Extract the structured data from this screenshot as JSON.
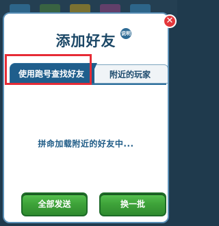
{
  "dialog": {
    "title": "添加好友",
    "badge": "说明",
    "close_icon": "close-icon",
    "tabs": [
      {
        "label": "使用跑号查找好友",
        "active": true
      },
      {
        "label": "附近的玩家",
        "active": false
      }
    ],
    "loading_text": "拼命加载附近的好友中...",
    "buttons": {
      "send_all": "全部发送",
      "refresh": "换一批"
    }
  },
  "colors": {
    "title": "#1b4766",
    "active_tab": "#1f5e8c",
    "highlight": "#e62b35",
    "button_green": "#3fa43a",
    "close_red": "#e4373b"
  }
}
